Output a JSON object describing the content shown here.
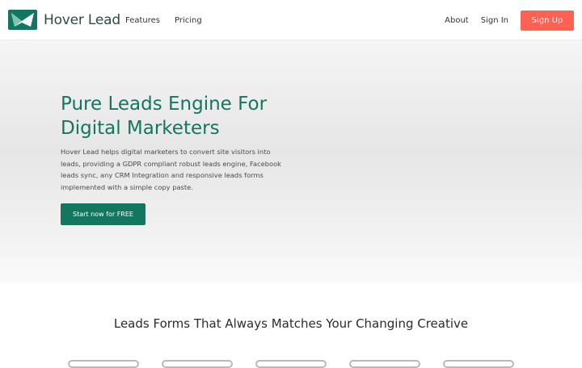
{
  "header": {
    "brand": "Hover Lead",
    "nav_left": [
      "Features",
      "Pricing"
    ],
    "nav_right": [
      "About",
      "Sign In"
    ],
    "signup_label": "Sign Up"
  },
  "hero": {
    "title_line1": "Pure Leads Engine For",
    "title_line2": "Digital Marketers",
    "description": "Hover Lead helps digital marketers to convert site visitors into leads, providing a GDPR compliant robust leads engine, Facebook leads sync, any CRM Integration and responsive leads forms implemented with a simple copy paste.",
    "cta_label": "Start now for FREE"
  },
  "section": {
    "title": "Leads Forms That Always Matches Your Changing Creative"
  },
  "colors": {
    "brand_green": "#13765e",
    "signup_red": "#ff6152"
  }
}
